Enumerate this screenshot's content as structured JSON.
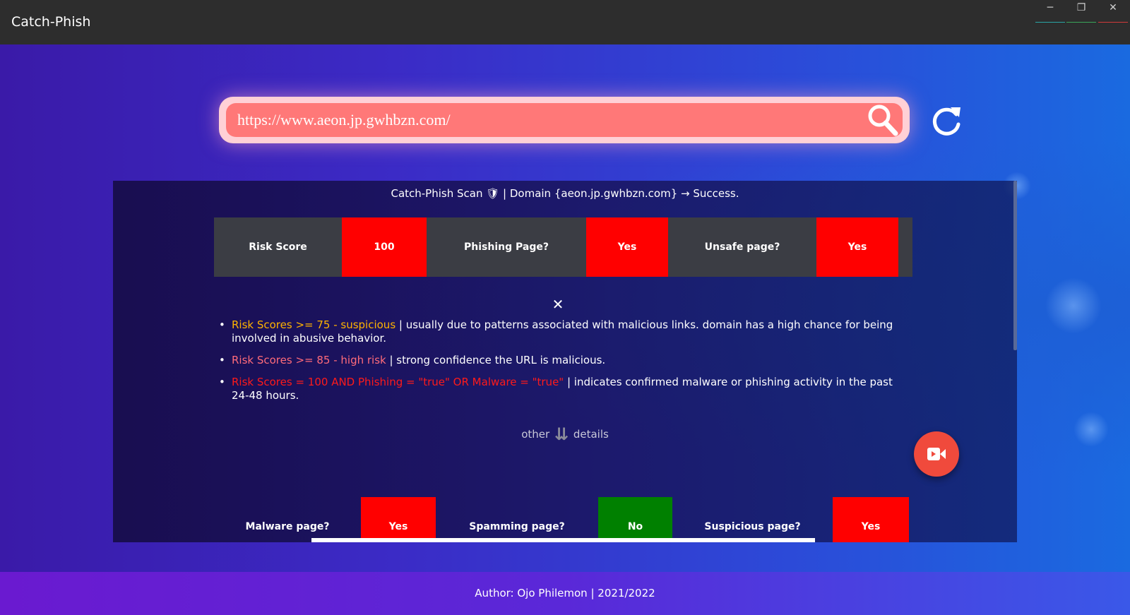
{
  "window": {
    "title": "Catch-Phish",
    "minimize_glyph": "─",
    "maximize_glyph": "❐",
    "close_glyph": "✕"
  },
  "search": {
    "value": "https://www.aeon.jp.gwhbzn.com/",
    "search_icon": "search-icon",
    "refresh_icon": "refresh-icon"
  },
  "scan": {
    "title": "Catch-Phish Scan 🛡 | Domain {aeon.jp.gwhbzn.com} → Success.",
    "summary": [
      {
        "label": "Risk Score",
        "value": "100"
      },
      {
        "label": "Phishing Page?",
        "value": "Yes"
      },
      {
        "label": "Unsafe page?",
        "value": "Yes"
      }
    ],
    "close_glyph": "✕",
    "legend": [
      {
        "highlight": "Risk Scores >= 75 - suspicious",
        "text": " | usually due to patterns associated with malicious links. domain has a high chance for being involved in abusive behavior."
      },
      {
        "highlight": "Risk Scores >= 85 - high risk",
        "text": " | strong confidence the URL is malicious."
      },
      {
        "highlight": "Risk Scores = 100 AND Phishing = \"true\" OR Malware = \"true\"",
        "text": " | indicates confirmed malware or phishing activity in the past 24-48 hours."
      }
    ],
    "other_label": "other",
    "other_arrow": "⇊",
    "details_label": "details",
    "details": [
      {
        "label": "Malware page?",
        "value": "Yes"
      },
      {
        "label": "Spamming page?",
        "value": "No"
      },
      {
        "label": "Suspicious page?",
        "value": "Yes"
      }
    ]
  },
  "colors": {
    "danger": "#ff0000",
    "safe": "#008000",
    "suspicious": "#ffb300",
    "high_risk": "#ff6b7a"
  },
  "footer": {
    "text": "Author: Ojo Philemon | 2021/2022"
  }
}
